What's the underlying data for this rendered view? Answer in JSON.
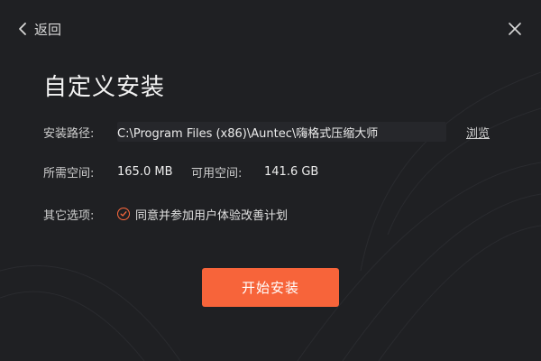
{
  "header": {
    "back_label": "返回",
    "back_icon": "chevron-left-icon",
    "close_icon": "close-icon"
  },
  "title": "自定义安装",
  "install_path": {
    "label": "安装路径:",
    "value": "C:\\Program Files (x86)\\Auntec\\嗨格式压缩大师",
    "browse_label": "浏览"
  },
  "space": {
    "required_label": "所需空间:",
    "required_value": "165.0 MB",
    "available_label": "可用空间:",
    "available_value": "141.6 GB"
  },
  "options": {
    "label": "其它选项:",
    "agree_text": "同意并参加用户体验改善计划",
    "agree_checked": true
  },
  "start_button": "开始安装",
  "colors": {
    "background": "#1f2023",
    "accent": "#f7643a",
    "text": "#e6e6e6"
  }
}
